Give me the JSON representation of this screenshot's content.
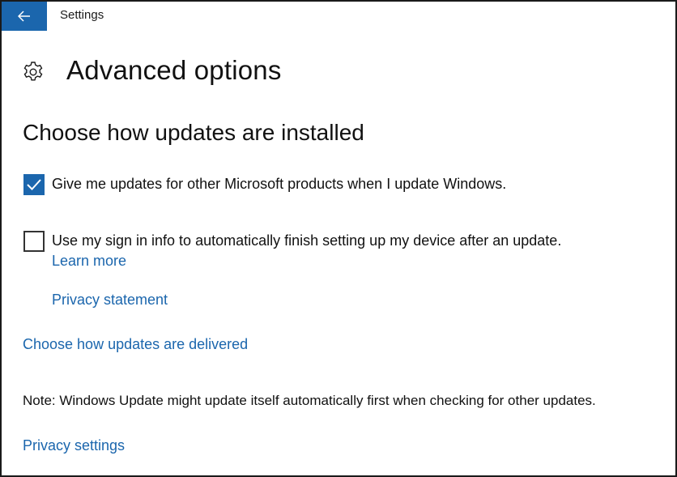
{
  "window": {
    "app_title": "Settings",
    "accent_color": "#1b66ad",
    "back_icon": "arrow-left-icon"
  },
  "header": {
    "icon": "gear-icon",
    "title": "Advanced options"
  },
  "section": {
    "title": "Choose how updates are installed",
    "options": [
      {
        "label": "Give me updates for other Microsoft products when I update Windows.",
        "checked": true
      },
      {
        "label": "Use my sign in info to automatically finish setting up my device after an update.",
        "checked": false
      }
    ],
    "learn_more": "Learn more",
    "privacy_statement": "Privacy statement"
  },
  "links": {
    "delivery": "Choose how updates are delivered",
    "privacy_settings": "Privacy settings"
  },
  "note": "Note: Windows Update might update itself automatically first when checking for other updates."
}
